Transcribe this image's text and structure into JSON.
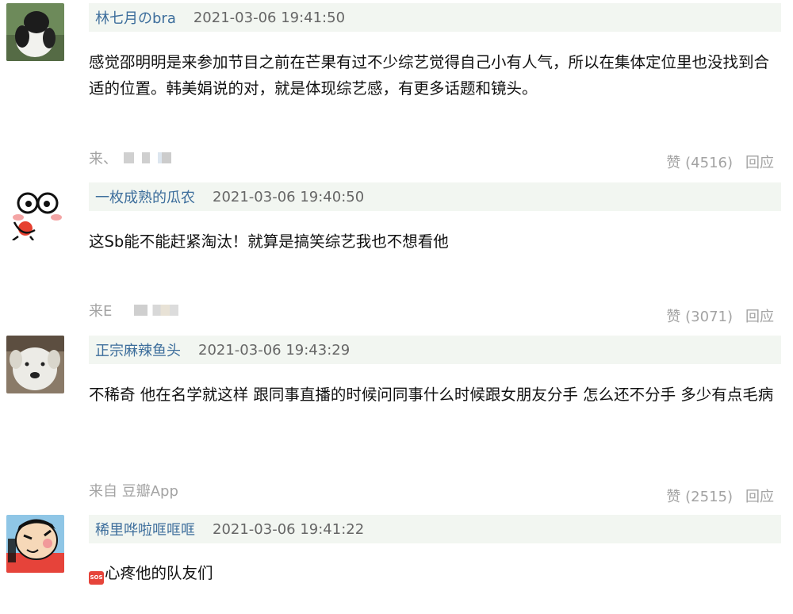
{
  "comments": [
    {
      "author": "林七月のbra",
      "time": "2021-03-06 19:41:50",
      "content": "感觉邵明明是来参加节目之前在芒果有过不少综艺觉得自己小有人气，所以在集体定位里也没找到合适的位置。韩美娟说的对，就是体现综艺感，有更多话题和镜头。",
      "source": "来、",
      "likes": "赞 (4516)",
      "reply": "回应",
      "avatar_icon": "panda-avatar"
    },
    {
      "author": "一枚成熟的瓜农",
      "time": "2021-03-06 19:40:50",
      "content": "这Sb能不能赶紧淘汰！就算是搞笑综艺我也不想看他",
      "source": "来E",
      "likes": "赞 (3071)",
      "reply": "回应",
      "avatar_icon": "cartoon-face-avatar"
    },
    {
      "author": "正宗麻辣鱼头",
      "time": "2021-03-06 19:43:29",
      "content": "不稀奇 他在名学就这样 跟同事直播的时候问同事什么时候跟女朋友分手 怎么还不分手 多少有点毛病",
      "source": "来自 豆瓣App",
      "likes": "赞 (2515)",
      "reply": "回应",
      "avatar_icon": "white-dog-avatar"
    },
    {
      "author": "稀里哗啦哐哐哐",
      "time": "2021-03-06 19:41:22",
      "content_icon": "SOS",
      "content": "心疼他的队友们",
      "avatar_icon": "crayon-shin-chan-avatar"
    }
  ],
  "colors": {
    "author_link": "#3d6e9c",
    "header_bg": "#f2f6f1",
    "meta_text": "#a3a3a3"
  }
}
